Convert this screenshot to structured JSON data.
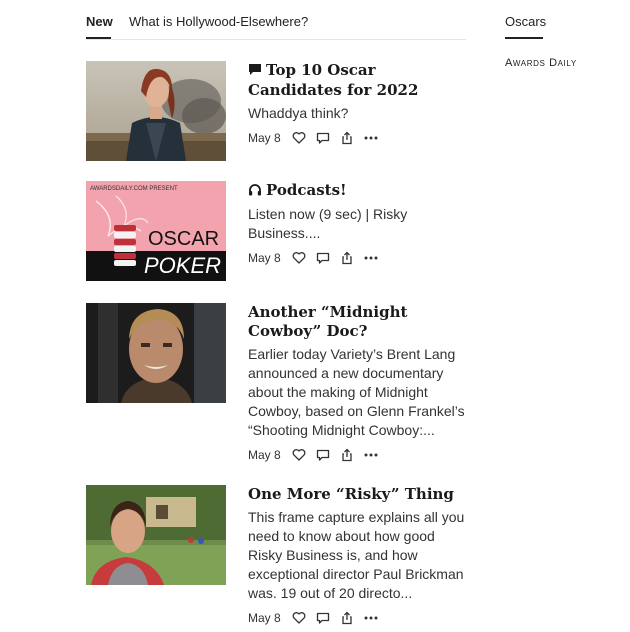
{
  "nav": {
    "tabs": [
      {
        "label": "New"
      },
      {
        "label": "What is Hollywood-Elsewhere?"
      }
    ]
  },
  "sidebar": {
    "tab": "Oscars",
    "brand": "Awards Daily"
  },
  "posts": [
    {
      "title": "Top 10 Oscar Candidates for 2022",
      "title_icon": "speech-bubble-icon",
      "excerpt": "Whaddya think?",
      "date": "May 8",
      "thumbnail": "black-widow-still"
    },
    {
      "title": "Podcasts!",
      "title_icon": "headphones-icon",
      "excerpt": "Listen now (9 sec) | Risky Business....",
      "date": "May 8",
      "thumbnail": "oscar-poker-logo",
      "thumb_text": {
        "small": "AWARDSDAILY.COM PRESENT",
        "line1": "OSCAR",
        "line2": "POKER"
      }
    },
    {
      "title": "Another “Midnight Cowboy” Doc?",
      "excerpt": "Earlier today Variety’s Brent Lang announced a new documentary about the making of Midnight Cowboy, based on Glenn Frankel’s “Shooting Midnight Cowboy:...",
      "date": "May 8",
      "thumbnail": "midnight-cowboy-still"
    },
    {
      "title": "One More “Risky” Thing",
      "excerpt": "This frame capture explains all you need to know about how good Risky Business is, and how exceptional director Paul Brickman was. 19 out of 20 directo...",
      "date": "May 8",
      "thumbnail": "risky-business-still"
    }
  ],
  "colors": {
    "text": "#222222",
    "divider": "#e6e6e6",
    "poker_pink": "#f2a3ad",
    "poker_red": "#c0303a"
  }
}
